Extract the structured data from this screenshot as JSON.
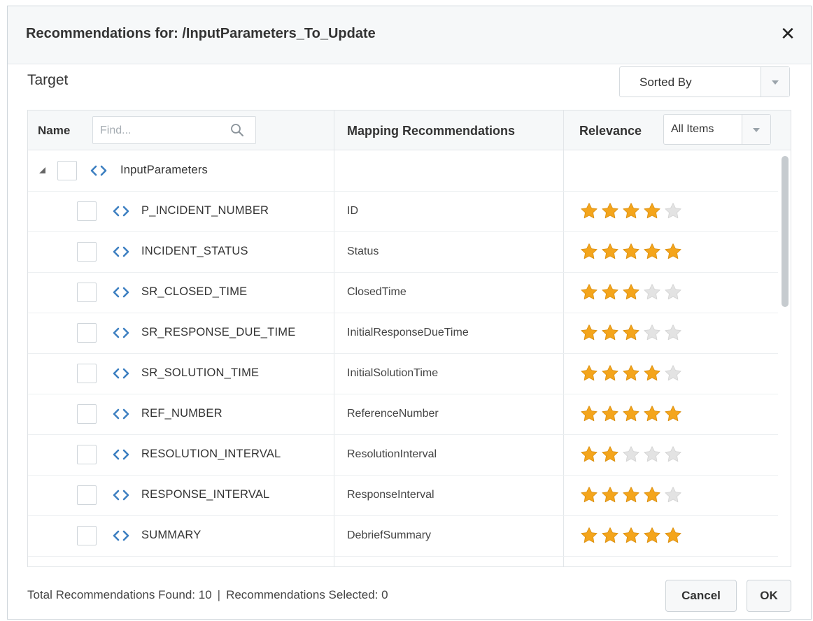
{
  "dialog": {
    "title": "Recommendations for: /InputParameters_To_Update",
    "close_label": "✕"
  },
  "target": {
    "label": "Target",
    "sort_select": {
      "selected": "Sorted By"
    }
  },
  "table": {
    "headers": {
      "name": "Name",
      "mapping": "Mapping Recommendations",
      "relevance": "Relevance"
    },
    "find_placeholder": "Find...",
    "relevance_filter": {
      "selected": "All Items"
    },
    "parent": {
      "name": "InputParameters",
      "expanded": true
    },
    "rows": [
      {
        "name": "P_INCIDENT_NUMBER",
        "mapping": "ID",
        "relevance": 4
      },
      {
        "name": "INCIDENT_STATUS",
        "mapping": "Status",
        "relevance": 5
      },
      {
        "name": "SR_CLOSED_TIME",
        "mapping": "ClosedTime",
        "relevance": 3
      },
      {
        "name": "SR_RESPONSE_DUE_TIME",
        "mapping": "InitialResponseDueTime",
        "relevance": 3
      },
      {
        "name": "SR_SOLUTION_TIME",
        "mapping": "InitialSolutionTime",
        "relevance": 4
      },
      {
        "name": "REF_NUMBER",
        "mapping": "ReferenceNumber",
        "relevance": 5
      },
      {
        "name": "RESOLUTION_INTERVAL",
        "mapping": "ResolutionInterval",
        "relevance": 2
      },
      {
        "name": "RESPONSE_INTERVAL",
        "mapping": "ResponseInterval",
        "relevance": 4
      },
      {
        "name": "SUMMARY",
        "mapping": "DebriefSummary",
        "relevance": 5
      }
    ],
    "max_relevance": 5
  },
  "footer": {
    "total_text": "Total Recommendations Found: 10",
    "separator": "|",
    "selected_text": "Recommendations Selected: 0",
    "cancel_label": "Cancel",
    "ok_label": "OK"
  },
  "colors": {
    "star_filled": "#f4a51c",
    "star_empty": "#e3e3e3",
    "code_icon": "#3d7fc1"
  },
  "icons": {
    "close": "close-icon",
    "search": "search-icon",
    "expander": "expanded-triangle-icon",
    "element": "code-brackets-icon",
    "star": "star-icon"
  }
}
